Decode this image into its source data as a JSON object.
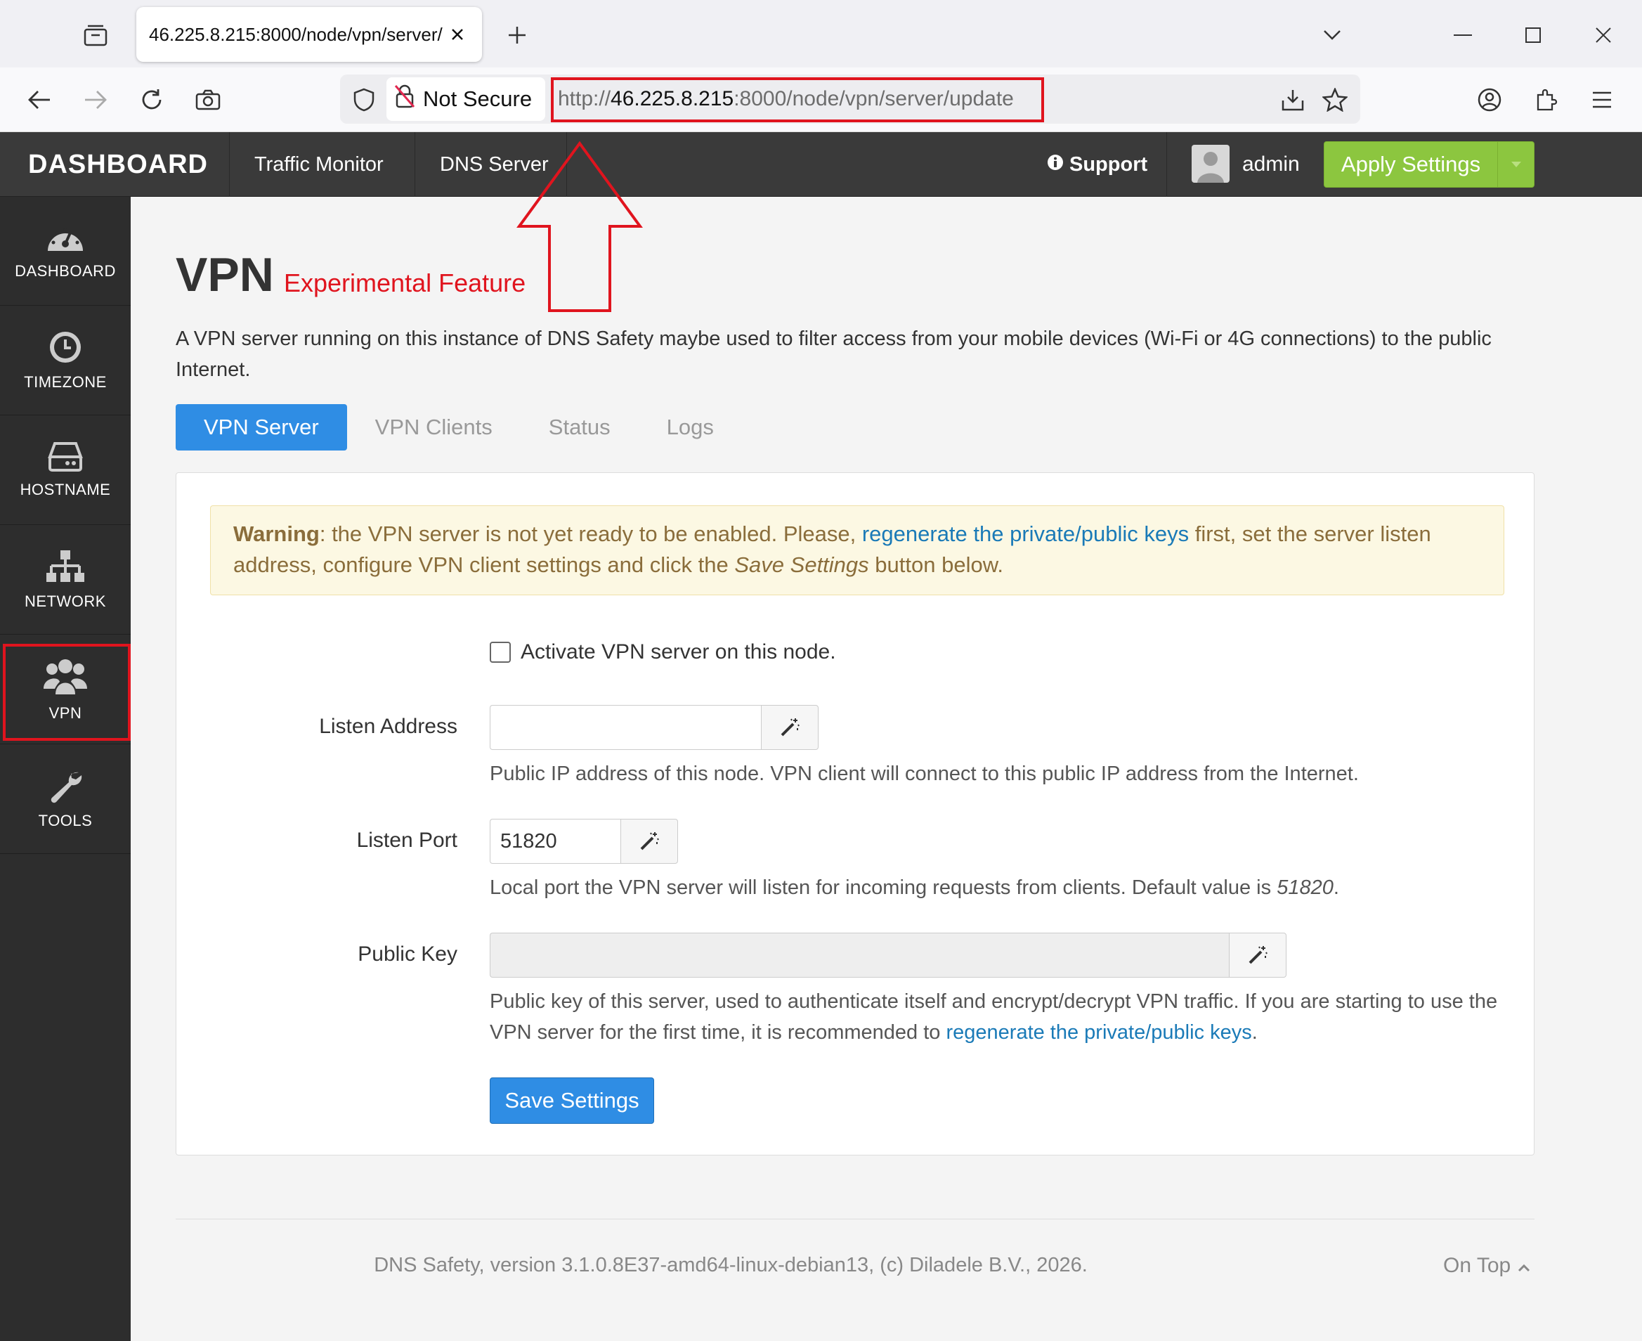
{
  "browser": {
    "tab_title": "46.225.8.215:8000/node/vpn/server/",
    "security_label": "Not Secure",
    "url_prefix": "http://",
    "url_host": "46.225.8.215",
    "url_rest": ":8000/node/vpn/server/update"
  },
  "topnav": {
    "brand": "DASHBOARD",
    "links": [
      "Traffic Monitor",
      "DNS Server"
    ],
    "support": "Support",
    "user": "admin",
    "apply": "Apply Settings"
  },
  "sidebar": {
    "items": [
      {
        "label": "DASHBOARD",
        "icon": "dashboard-gauge-icon"
      },
      {
        "label": "TIMEZONE",
        "icon": "clock-icon"
      },
      {
        "label": "HOSTNAME",
        "icon": "hard-drive-icon"
      },
      {
        "label": "NETWORK",
        "icon": "network-sitemap-icon"
      },
      {
        "label": "VPN",
        "icon": "users-group-icon"
      },
      {
        "label": "TOOLS",
        "icon": "wrench-icon"
      }
    ]
  },
  "page": {
    "title": "VPN",
    "subtitle": "Experimental Feature",
    "intro": "A VPN server running on this instance of DNS Safety maybe used to filter access from your mobile devices (Wi-Fi or 4G connections) to the public Internet."
  },
  "tabs": [
    "VPN Server",
    "VPN Clients",
    "Status",
    "Logs"
  ],
  "warning": {
    "strong": "Warning",
    "text1": ": the VPN server is not yet ready to be enabled. Please, ",
    "link": "regenerate the private/public keys",
    "text2": " first, set the server listen address, configure VPN client settings and click the ",
    "emph": "Save Settings",
    "text3": " button below."
  },
  "form": {
    "activate_label": "Activate VPN server on this node.",
    "listen_address": {
      "label": "Listen Address",
      "value": "",
      "help": "Public IP address of this node. VPN client will connect to this public IP address from the Internet."
    },
    "listen_port": {
      "label": "Listen Port",
      "value": "51820",
      "help": "Local port the VPN server will listen for incoming requests from clients. Default value is ",
      "help_default": "51820",
      "help_end": "."
    },
    "public_key": {
      "label": "Public Key",
      "value": "",
      "help": "Public key of this server, used to authenticate itself and encrypt/decrypt VPN traffic. If you are starting to use the VPN server for the first time, it is recommended to ",
      "help_link": "regenerate the private/public keys",
      "help_end": "."
    },
    "save": "Save Settings"
  },
  "footer": {
    "text": "DNS Safety, version 3.1.0.8E37-amd64-linux-debian13, (c) Diladele B.V., 2026.",
    "on_top": "On Top"
  },
  "colors": {
    "accent": "#2f8de4",
    "apply_green": "#8cc63f",
    "annotation_red": "#e0141e"
  }
}
